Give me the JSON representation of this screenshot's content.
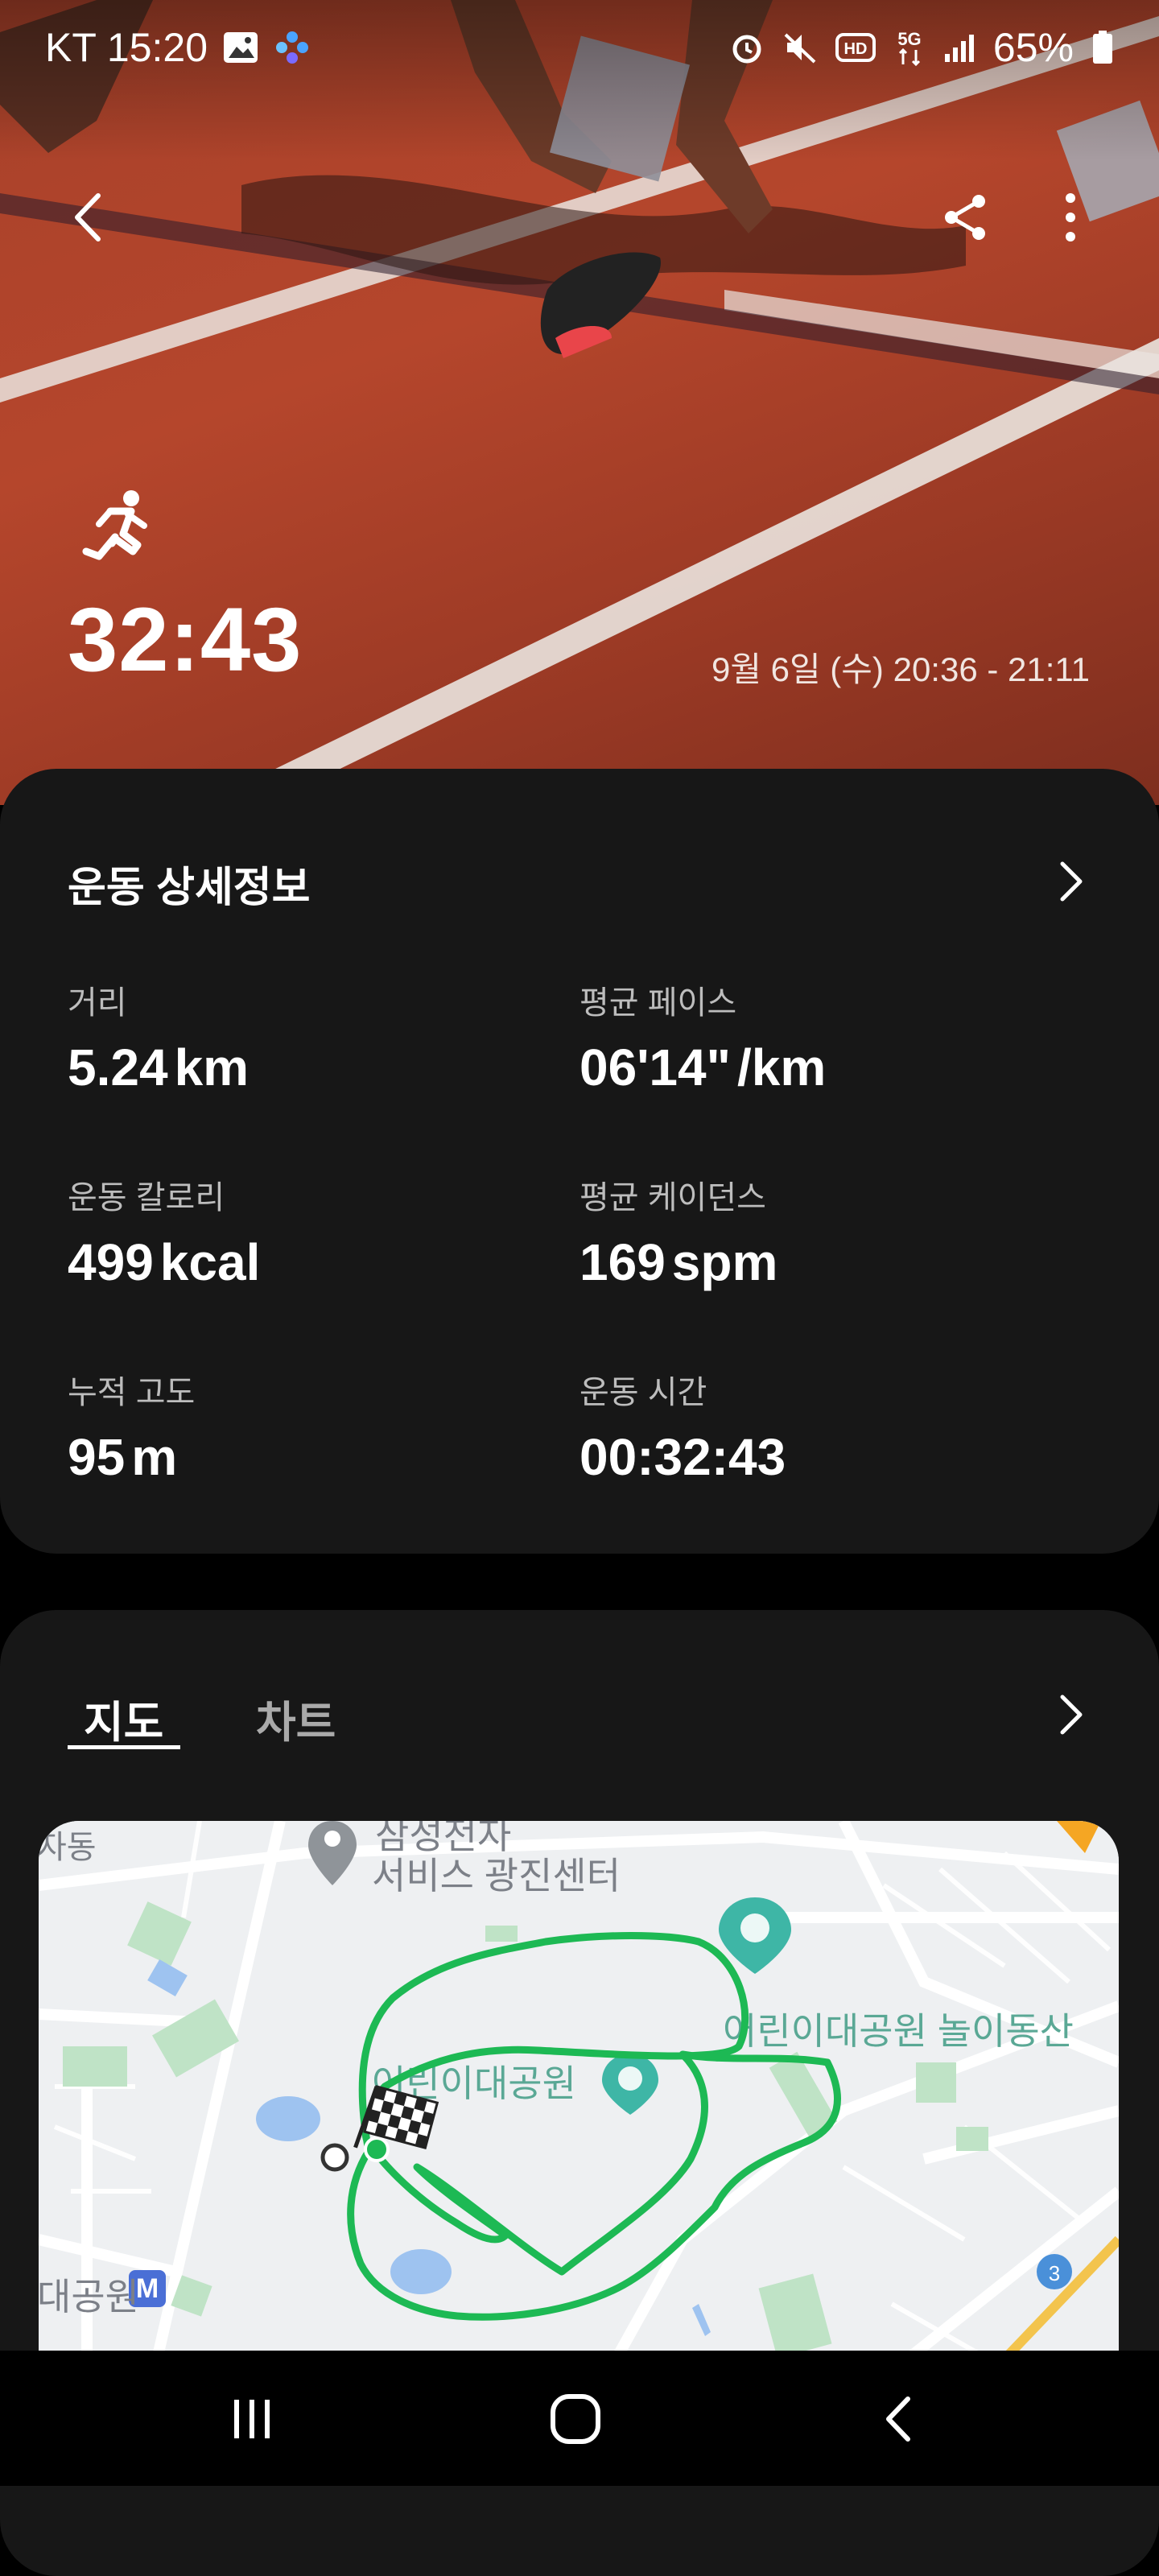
{
  "status_bar": {
    "carrier_time": "KT 15:20",
    "battery": "65%"
  },
  "header": {
    "duration": "32:43",
    "date_range": "9월 6일 (수) 20:36 - 21:11"
  },
  "details": {
    "title": "운동 상세정보",
    "metrics": [
      {
        "label": "거리",
        "value": "5.24",
        "unit": "km"
      },
      {
        "label": "평균 페이스",
        "value": "06'14\"",
        "unit": "/km"
      },
      {
        "label": "운동 칼로리",
        "value": "499",
        "unit": "kcal"
      },
      {
        "label": "평균 케이던스",
        "value": "169",
        "unit": "spm"
      },
      {
        "label": "누적 고도",
        "value": "95",
        "unit": "m"
      },
      {
        "label": "운동 시간",
        "value": "00:32:43",
        "unit": ""
      }
    ]
  },
  "map_section": {
    "tabs": [
      "지도",
      "차트"
    ],
    "active_tab": "지도",
    "map_labels": {
      "service_center_1": "삼성전자",
      "service_center_2": "서비스 광진센터",
      "park_main": "어린이대공원",
      "park_play": "어린이대공원 놀이동산",
      "station": "대공원",
      "district": "자동",
      "road_number": "3"
    },
    "route_color": "#1db954"
  },
  "colors": {
    "card_bg": "#171717",
    "accent_green": "#1db954"
  },
  "icons": [
    "back-icon",
    "share-icon",
    "more-icon",
    "running-icon",
    "chevron-right-icon",
    "gallery-icon",
    "alarm-icon",
    "mute-icon",
    "signal-icon",
    "battery-icon",
    "finish-flag-icon",
    "recent-apps-icon",
    "home-icon",
    "nav-back-icon"
  ]
}
